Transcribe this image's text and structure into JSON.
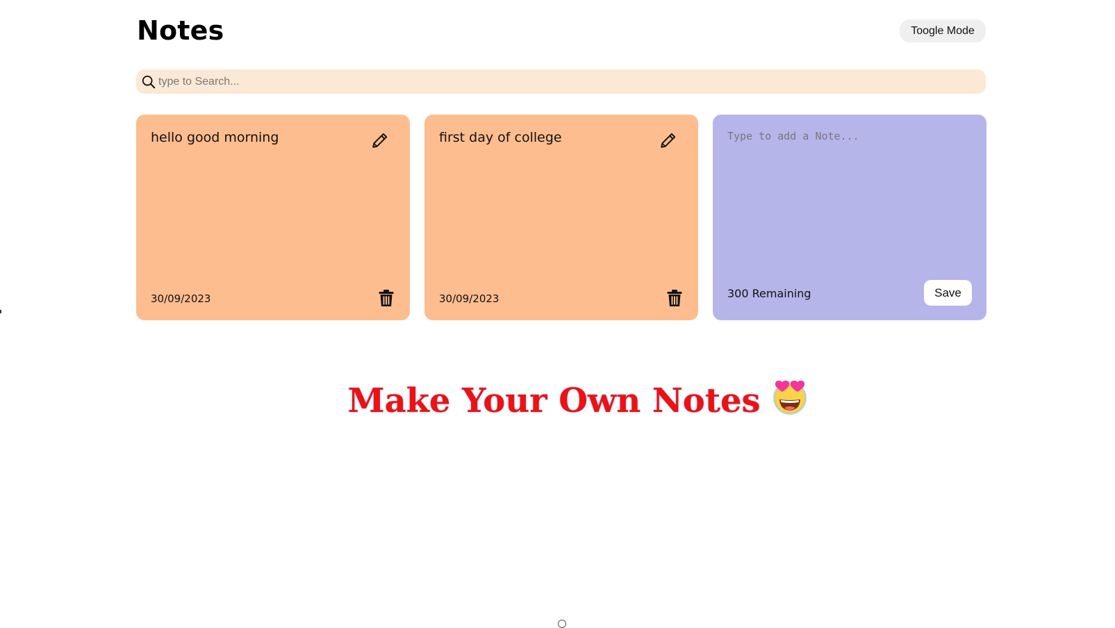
{
  "header": {
    "title": "Notes",
    "toggle_label": "Toogle Mode"
  },
  "search": {
    "placeholder": "type to Search...",
    "icon": "search-icon"
  },
  "notes": [
    {
      "text": "hello good morning",
      "date": "30/09/2023",
      "color": "#fdbd8f"
    },
    {
      "text": "first day of college",
      "date": "30/09/2023",
      "color": "#fdbd8f"
    }
  ],
  "new_note": {
    "placeholder": "Type to add a Note...",
    "remaining": "300 Remaining",
    "save_label": "Save",
    "color": "#b6b5ea"
  },
  "banner": {
    "tagline": "Make Your Own Notes",
    "emoji": "heart-eyes-emoji"
  },
  "colors": {
    "search_bg": "#fbe9d6",
    "tagline": "#ee1111"
  }
}
